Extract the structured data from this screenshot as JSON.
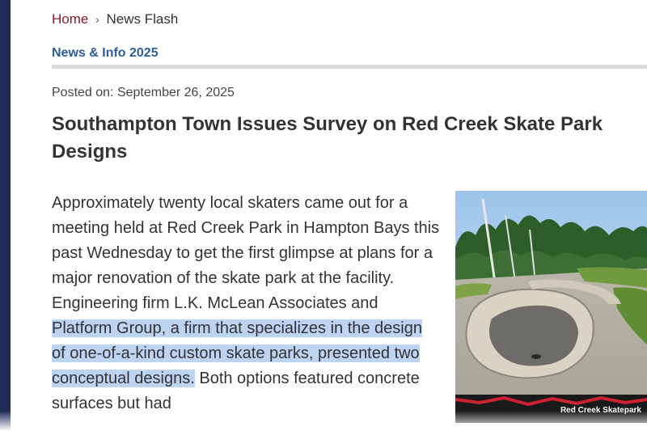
{
  "breadcrumb": {
    "home": "Home",
    "separator": "›",
    "current": "News Flash"
  },
  "section": {
    "title": "News & Info 2025"
  },
  "article": {
    "posted": "Posted on: September 26, 2025",
    "title": "Southampton Town Issues Survey on Red Creek Skate Park Designs",
    "para_before_highlight": "Approximately twenty local skaters came out for a meeting held at Red Creek Park in Hampton Bays this past Wednesday to get the first glimpse at plans for a major renovation of the skate park at the facility.  Engineering firm L.K. McLean Associates and ",
    "para_highlight": "Platform Group, a firm that specializes in the design of one-of-a-kind custom skate parks, presented two conceptual designs.",
    "para_after_highlight": " Both options featured concrete surfaces but had"
  },
  "image": {
    "banner_text": "Red Creek Skatepark"
  },
  "colors": {
    "left_bar": "#1f2a55",
    "link": "#8a1d2d",
    "section_heading": "#2e5d9f",
    "highlight": "#bcd3f2"
  }
}
